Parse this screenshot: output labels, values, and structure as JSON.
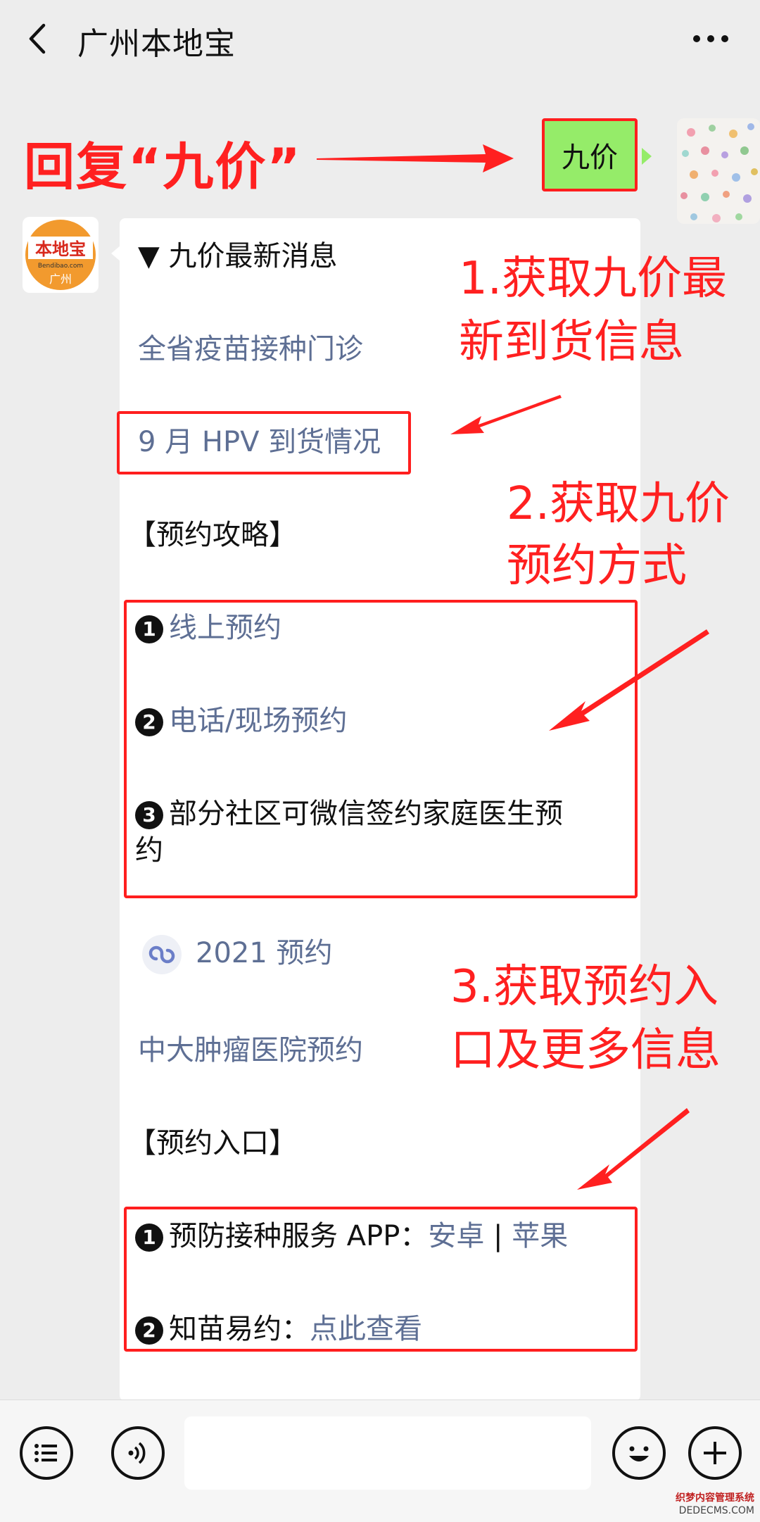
{
  "header": {
    "title": "广州本地宝"
  },
  "annotation_reply": "回复“九价”",
  "user_message": "九价",
  "bot": {
    "avatar_text": "本地宝",
    "avatar_domain": "Bendibao.com",
    "avatar_city": "广州"
  },
  "card": {
    "heading": "▼ 九价最新消息",
    "links1": [
      "全省疫苗接种门诊",
      "9 月 HPV 到货情况"
    ],
    "section_booking_guide": "【预约攻略】",
    "guide_items": [
      {
        "num": "1",
        "text": "线上预约"
      },
      {
        "num": "2",
        "text": "电话/现场预约"
      },
      {
        "num": "3",
        "text": "部分社区可微信签约家庭医生预",
        "text2": "约"
      }
    ],
    "miniprogram": "2021 预约",
    "hospital_link": "中大肿瘤医院预约",
    "section_entry": "【预约入口】",
    "entry_items": [
      {
        "num": "1",
        "prefix": "预防接种服务 APP：",
        "link_a": "安卓",
        "sep": " | ",
        "link_b": "苹果"
      },
      {
        "num": "2",
        "prefix": "知苗易约：",
        "link_a": "点此查看"
      }
    ]
  },
  "annotations": {
    "a1_line1": "1.获取九价最",
    "a1_line2": "新到货信息",
    "a2_line1": "2.获取九价",
    "a2_line2": "预约方式",
    "a3_line1": "3.获取预约入",
    "a3_line2": "口及更多信息"
  },
  "watermark": {
    "cn": "织梦内容管理系统",
    "en": "DEDECMS.COM"
  },
  "colors": {
    "annotation": "#ff2020",
    "bubble": "#95ec69",
    "link": "#5e6f94",
    "background": "#ededed"
  }
}
